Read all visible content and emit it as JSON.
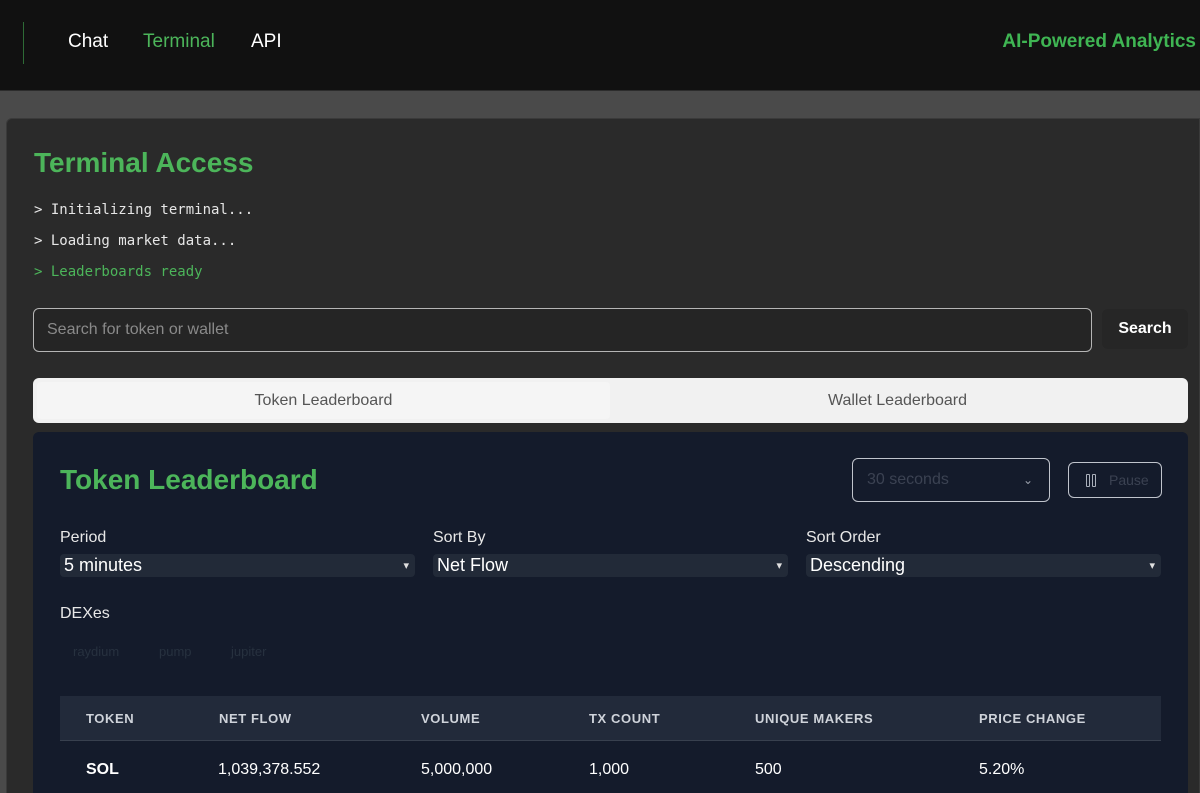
{
  "nav": {
    "links": [
      "Chat",
      "Terminal",
      "API"
    ],
    "brand": "AI-Powered Analytics"
  },
  "terminal": {
    "title": "Terminal Access",
    "log": [
      "> Initializing terminal...",
      "> Loading market data...",
      "> Leaderboards ready"
    ],
    "search_placeholder": "Search for token or wallet",
    "search_button": "Search"
  },
  "tabs": [
    "Token Leaderboard",
    "Wallet Leaderboard"
  ],
  "board": {
    "title": "Token Leaderboard",
    "refresh_interval": "30 seconds",
    "pause_label": "Pause",
    "filters": {
      "period_label": "Period",
      "period_value": "5 minutes",
      "sort_by_label": "Sort By",
      "sort_by_value": "Net Flow",
      "sort_order_label": "Sort Order",
      "sort_order_value": "Descending"
    },
    "dexes_label": "DEXes",
    "dexes": [
      "raydium",
      "pump",
      "jupiter"
    ],
    "columns": [
      "TOKEN",
      "NET FLOW",
      "VOLUME",
      "TX COUNT",
      "UNIQUE MAKERS",
      "PRICE CHANGE"
    ],
    "rows": [
      [
        "SOL",
        "1,039,378.552",
        "5,000,000",
        "1,000",
        "500",
        "5.20%"
      ]
    ]
  },
  "colors": {
    "accent_green": "#4cb55a",
    "nav_bg": "#111111",
    "board_bg": "#141b2b"
  }
}
